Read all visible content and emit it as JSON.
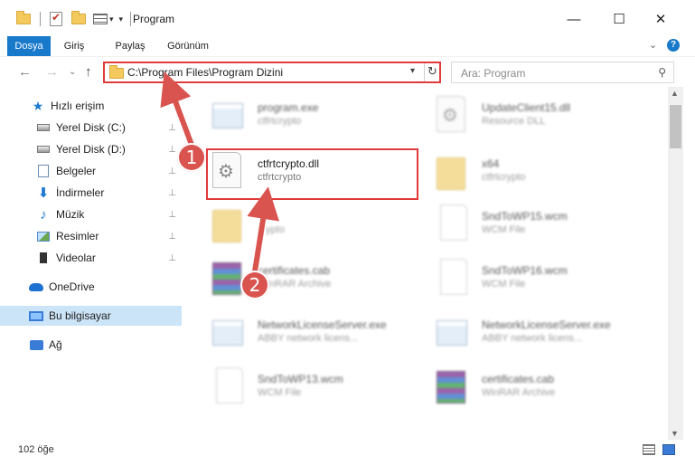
{
  "window": {
    "title": "Program",
    "controls": {
      "minimize": "—",
      "maximize": "☐",
      "close": "✕"
    }
  },
  "ribbon": {
    "tabs": [
      "Dosya",
      "Giriş",
      "Paylaş",
      "Görünüm"
    ],
    "help": "?"
  },
  "navbar": {
    "back": "←",
    "forward": "→",
    "recent": "⌄",
    "up": "↑",
    "address": "C:\\Program Files\\Program Dizini",
    "refresh": "↻",
    "search_placeholder": "Ara: Program",
    "search_icon": "⚲"
  },
  "sidebar": {
    "items": [
      {
        "label": "Hızlı erişim",
        "icon": "star-icon",
        "pinned": false
      },
      {
        "label": "Yerel Disk (C:)",
        "icon": "drive-c-icon",
        "pinned": true
      },
      {
        "label": "Yerel Disk (D:)",
        "icon": "drive-d-icon",
        "pinned": true
      },
      {
        "label": "Belgeler",
        "icon": "documents-icon",
        "pinned": true
      },
      {
        "label": "İndirmeler",
        "icon": "downloads-icon",
        "pinned": true
      },
      {
        "label": "Müzik",
        "icon": "music-icon",
        "pinned": true
      },
      {
        "label": "Resimler",
        "icon": "pictures-icon",
        "pinned": true
      },
      {
        "label": "Videolar",
        "icon": "videos-icon",
        "pinned": true
      },
      {
        "label": "OneDrive",
        "icon": "onedrive-icon",
        "pinned": false
      },
      {
        "label": "Bu bilgisayar",
        "icon": "this-pc-icon",
        "pinned": false,
        "selected": true
      },
      {
        "label": "Ağ",
        "icon": "network-icon",
        "pinned": false
      }
    ],
    "pin_glyph": "📌"
  },
  "files": [
    {
      "name": "program.exe",
      "sub": "ctfrtcrypto",
      "icon": "exe-icon",
      "blurred": true
    },
    {
      "name": "UpdateClient15.dll",
      "sub": "Resource DLL",
      "icon": "dll-icon",
      "blurred": true
    },
    {
      "name": "ctfrtcrypto.dll",
      "sub": "ctfrtcrypto",
      "icon": "dll-gear-icon",
      "blurred": false
    },
    {
      "name": "x64",
      "sub": "ctfrtcrypto",
      "icon": "folder-icon",
      "blurred": true
    },
    {
      "name": "",
      "sub": "crypto",
      "icon": "folder-icon",
      "blurred": true
    },
    {
      "name": "SndToWP15.wcm",
      "sub": "WCM File",
      "icon": "document-icon",
      "blurred": true
    },
    {
      "name": "certificates.cab",
      "sub": "WinRAR Archive",
      "icon": "winrar-icon",
      "blurred": true
    },
    {
      "name": "SndToWP16.wcm",
      "sub": "WCM File",
      "icon": "document-icon",
      "blurred": true
    },
    {
      "name": "NetworkLicenseServer.exe",
      "sub": "ABBY network licens...",
      "icon": "exe-window-icon",
      "blurred": true
    },
    {
      "name": "NetworkLicenseServer.exe",
      "sub": "ABBY network licens...",
      "icon": "exe-window-icon",
      "blurred": true
    },
    {
      "name": "SndToWP13.wcm",
      "sub": "WCM File",
      "icon": "document-icon",
      "blurred": true
    },
    {
      "name": "certificates.cab",
      "sub": "WinRAR Archive",
      "icon": "winrar-icon",
      "blurred": true
    }
  ],
  "annotations": {
    "step1": "1",
    "step2": "2",
    "accent": "#d9534f"
  },
  "status": {
    "count": "102 öğe"
  },
  "colors": {
    "accent_blue": "#1979ca",
    "highlight_red": "#e03a3a",
    "selection": "#cce4f7"
  }
}
